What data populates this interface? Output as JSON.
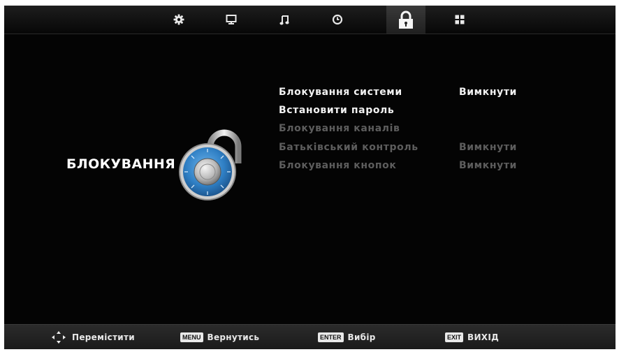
{
  "topbar": {
    "tabs": [
      {
        "icon": "gear-icon",
        "active": false
      },
      {
        "icon": "monitor-icon",
        "active": false
      },
      {
        "icon": "music-note-icon",
        "active": false
      },
      {
        "icon": "clock-icon",
        "active": false
      },
      {
        "icon": "lock-icon",
        "active": true
      },
      {
        "icon": "grid-icon",
        "active": false
      }
    ]
  },
  "menu": {
    "title": "БЛОКУВАННЯ",
    "items": [
      {
        "label": "Блокування системи",
        "value": "Вимкнути",
        "enabled": true
      },
      {
        "label": "Встановити пароль",
        "value": "",
        "enabled": true
      },
      {
        "label": "Блокування каналів",
        "value": "",
        "enabled": false
      },
      {
        "label": "Батьківський контроль",
        "value": "Вимкнути",
        "enabled": false
      },
      {
        "label": "Блокування кнопок",
        "value": "Вимкнути",
        "enabled": false
      }
    ]
  },
  "bottombar": {
    "move": {
      "icon": "arrows-icon",
      "label": "Перемістити"
    },
    "back": {
      "key": "MENU",
      "label": "Вернутись"
    },
    "select": {
      "key": "ENTER",
      "label": "Вибір"
    },
    "exit": {
      "key": "EXIT",
      "label": "ВИХІД"
    }
  },
  "colors": {
    "background": "#040404",
    "enabled_text": "#f2f2f2",
    "disabled_text": "#5d5d5d",
    "dial_blue": "#2f7fc4"
  }
}
